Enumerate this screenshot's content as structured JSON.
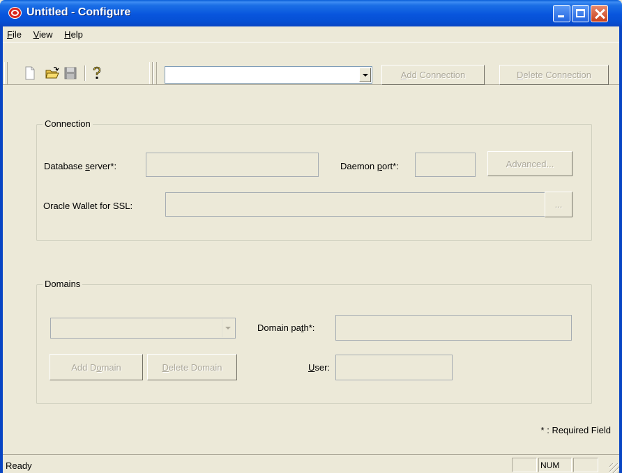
{
  "window": {
    "title": "Untitled - Configure"
  },
  "menu": {
    "file": {
      "accel": "F",
      "rest": "ile"
    },
    "view": {
      "accel": "V",
      "rest": "iew"
    },
    "help": {
      "accel": "H",
      "rest": "elp"
    }
  },
  "toolbar": {
    "connection_combo_value": "",
    "add_connection": {
      "accel": "A",
      "rest": "dd Connection"
    },
    "delete_connection": {
      "accel": "D",
      "rest": "elete Connection"
    }
  },
  "connection": {
    "group_label": "Connection",
    "db_server": {
      "pre": "Database ",
      "accel": "s",
      "post": "erver*:"
    },
    "db_server_value": "",
    "daemon_port": {
      "pre": "Daemon ",
      "accel": "p",
      "post": "ort*:"
    },
    "daemon_port_value": "",
    "advanced_label": "Advanced...",
    "wallet_label": "Oracle Wallet for SSL:",
    "wallet_value": "",
    "browse_label": "..."
  },
  "domains": {
    "group_label": "Domains",
    "domain_combo_value": "",
    "domain_path": {
      "pre": "Domain pa",
      "accel": "t",
      "post": "h*:"
    },
    "domain_path_value": "",
    "add_domain": {
      "pre": "Add D",
      "accel": "o",
      "post": "main"
    },
    "delete_domain": {
      "accel": "D",
      "rest": "elete Domain"
    },
    "user": {
      "accel": "U",
      "rest": "ser:"
    },
    "user_value": ""
  },
  "required_note": "* : Required Field",
  "status": {
    "text": "Ready",
    "num": "NUM"
  },
  "colors": {
    "titlebar": "#0855dd",
    "face": "#ece9d8",
    "disabled_text": "#aca899"
  }
}
